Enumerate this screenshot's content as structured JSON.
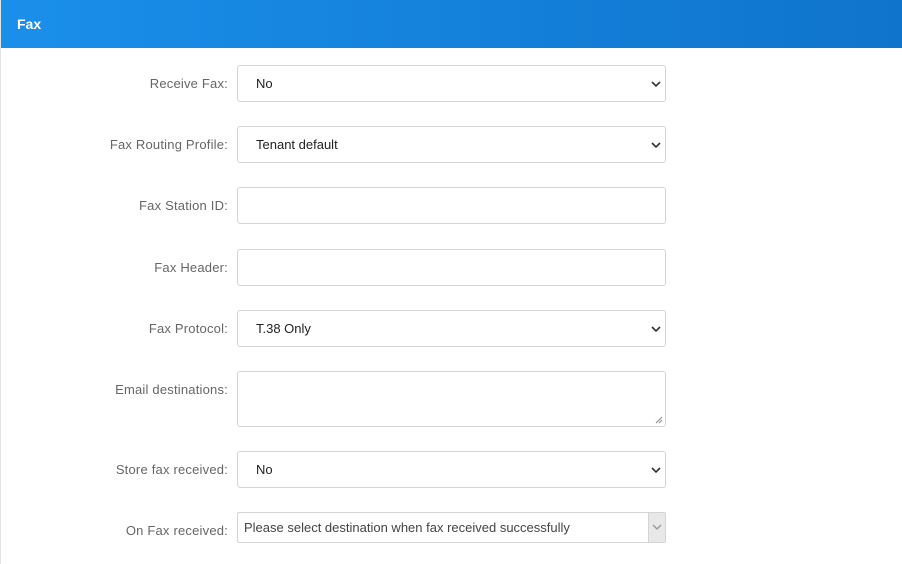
{
  "header": {
    "title": "Fax"
  },
  "fields": {
    "receive_fax": {
      "label": "Receive Fax:",
      "value": "No"
    },
    "routing_profile": {
      "label": "Fax Routing Profile:",
      "value": "Tenant default"
    },
    "station_id": {
      "label": "Fax Station ID:",
      "value": ""
    },
    "fax_header": {
      "label": "Fax Header:",
      "value": ""
    },
    "protocol": {
      "label": "Fax Protocol:",
      "value": "T.38 Only"
    },
    "email_destinations": {
      "label": "Email destinations:",
      "value": ""
    },
    "store_fax": {
      "label": "Store fax received:",
      "value": "No"
    },
    "on_fax_received": {
      "label": "On Fax received:",
      "placeholder": "Please select destination when fax received successfully"
    }
  },
  "icons": {
    "select_chevron": "chevron-down-icon",
    "resize_handle": "resize-grip-icon"
  },
  "colors": {
    "header_start": "#1a8fea",
    "header_end": "#0f74cc",
    "label_text": "#666666",
    "border": "#d4d4d4"
  }
}
